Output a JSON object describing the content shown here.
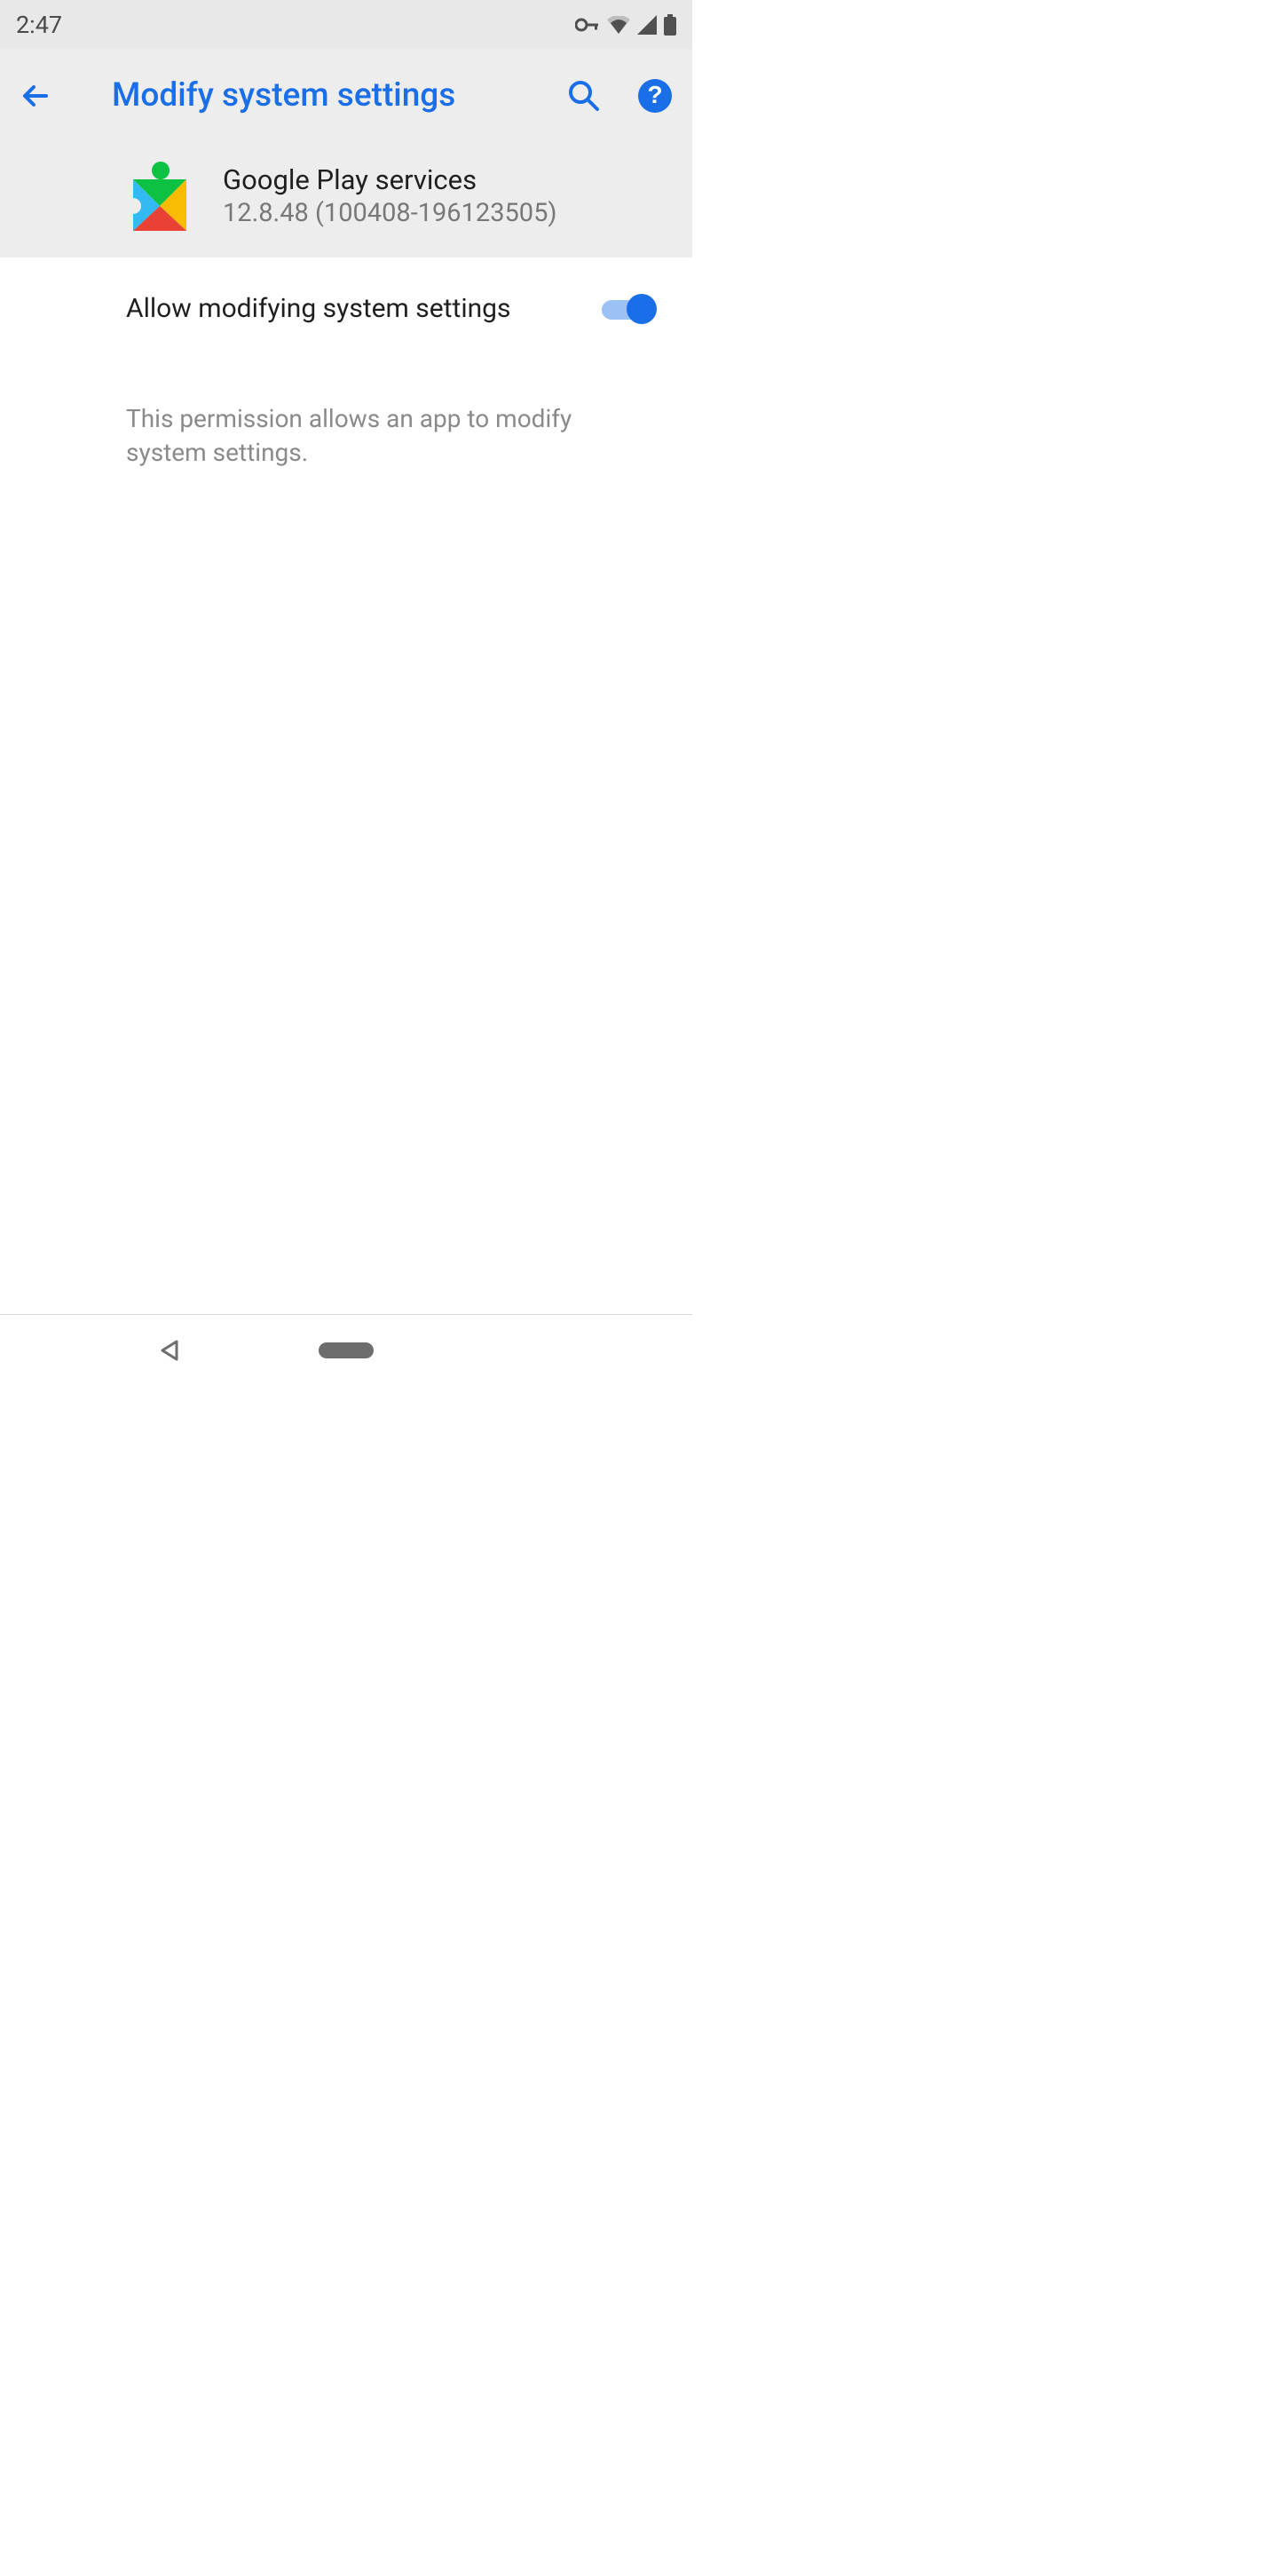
{
  "statusBar": {
    "time": "2:47"
  },
  "appBar": {
    "title": "Modify system settings"
  },
  "appInfo": {
    "name": "Google Play services",
    "version": "12.8.48 (100408-196123505)"
  },
  "setting": {
    "label": "Allow modifying system settings",
    "enabled": true
  },
  "description": "This permission allows an app to modify system settings."
}
